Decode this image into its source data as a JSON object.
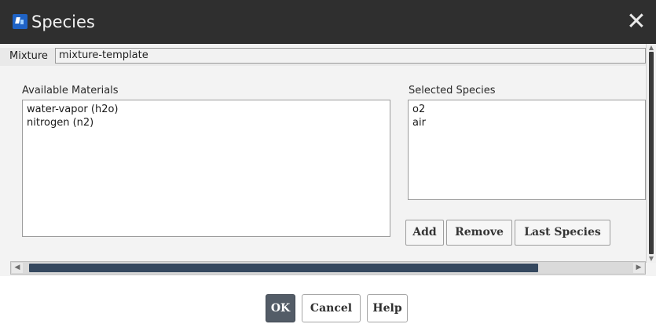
{
  "window": {
    "title": "Species",
    "close_glyph": "✕",
    "app_icon": "fluent-app-icon"
  },
  "mixture": {
    "label": "Mixture",
    "value": "mixture-template"
  },
  "available": {
    "label": "Available Materials",
    "items": [
      "water-vapor (h2o)",
      "nitrogen (n2)"
    ]
  },
  "selected": {
    "label": "Selected Species",
    "items": [
      "o2",
      "air"
    ]
  },
  "buttons": {
    "add": "Add",
    "remove": "Remove",
    "last_species": "Last Species"
  },
  "scroll": {
    "left_glyph": "◀",
    "right_glyph": "▶",
    "up_glyph": "▲",
    "down_glyph": "▼"
  },
  "footer": {
    "ok": "OK",
    "cancel": "Cancel",
    "help": "Help"
  },
  "colors": {
    "titlebar_bg": "#2f2f2f",
    "ok_bg": "#535c67",
    "scroll_thumb": "#35485f"
  }
}
